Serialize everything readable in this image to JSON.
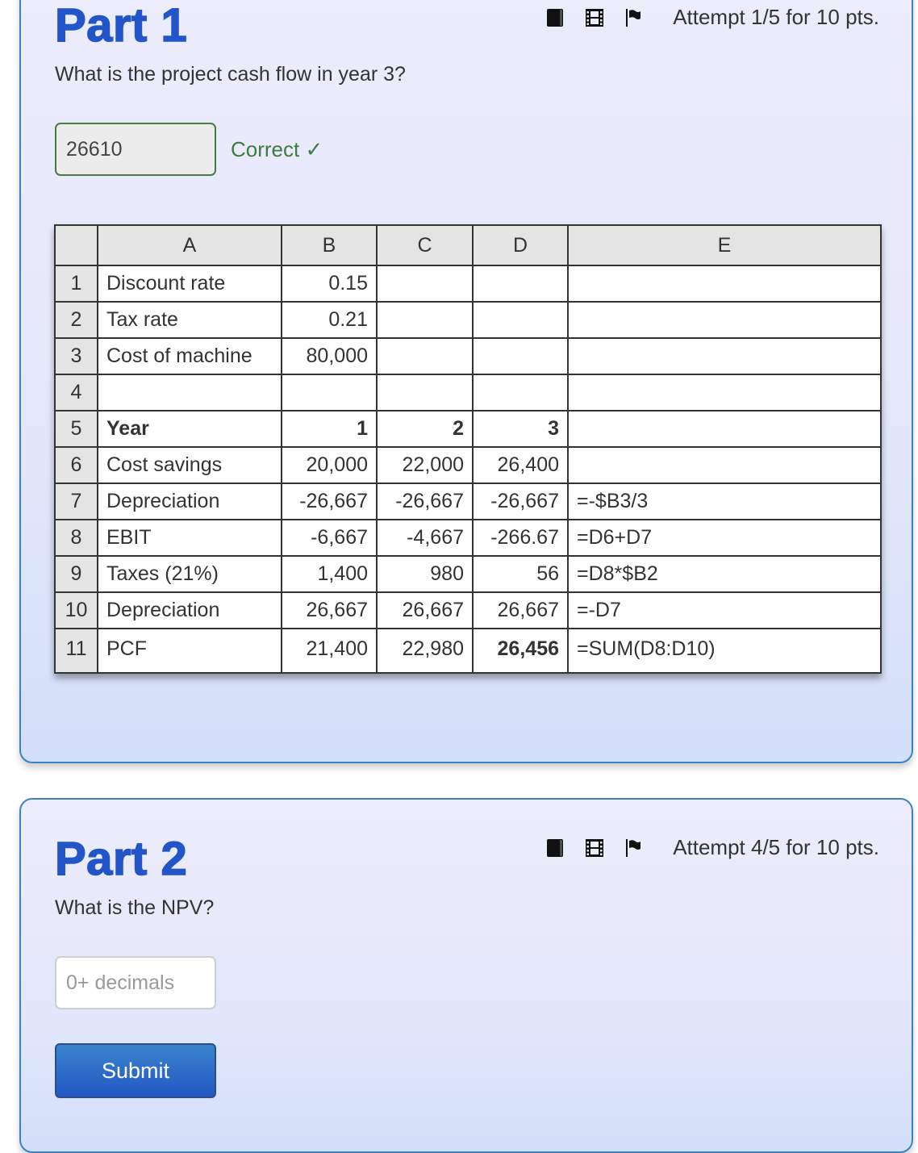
{
  "part1": {
    "title": "Part 1",
    "toolbar": {
      "icons": [
        "book-icon",
        "film-icon",
        "flag-icon"
      ],
      "attempt_text": "Attempt 1/5 for 10 pts."
    },
    "question": "What is the project cash flow in year 3?",
    "answer_value": "26610",
    "feedback": "Correct ✓",
    "feedback_color": "#3e7b3e",
    "spreadsheet": {
      "columns": [
        "",
        "A",
        "B",
        "C",
        "D",
        "E"
      ],
      "rows": [
        {
          "num": "1",
          "A": "Discount rate",
          "B": "0.15",
          "C": "",
          "D": "",
          "E": ""
        },
        {
          "num": "2",
          "A": "Tax rate",
          "B": "0.21",
          "C": "",
          "D": "",
          "E": ""
        },
        {
          "num": "3",
          "A": "Cost of machine",
          "B": "80,000",
          "C": "",
          "D": "",
          "E": ""
        },
        {
          "num": "4",
          "A": "",
          "B": "",
          "C": "",
          "D": "",
          "E": ""
        },
        {
          "num": "5",
          "A": "Year",
          "B": "1",
          "C": "2",
          "D": "3",
          "E": ""
        },
        {
          "num": "6",
          "A": "Cost savings",
          "B": "20,000",
          "C": "22,000",
          "D": "26,400",
          "E": ""
        },
        {
          "num": "7",
          "A": "Depreciation",
          "B": "-26,667",
          "C": "-26,667",
          "D": "-26,667",
          "E": "=-$B3/3"
        },
        {
          "num": "8",
          "A": "EBIT",
          "B": "-6,667",
          "C": "-4,667",
          "D": "-266.67",
          "E": "=D6+D7"
        },
        {
          "num": "9",
          "A": "Taxes (21%)",
          "B": "1,400",
          "C": "980",
          "D": "56",
          "E": "=D8*$B2"
        },
        {
          "num": "10",
          "A": "Depreciation",
          "B": "26,667",
          "C": "26,667",
          "D": "26,667",
          "E": "=-D7"
        },
        {
          "num": "11",
          "A": "PCF",
          "B": "21,400",
          "C": "22,980",
          "D": "26,456",
          "E": "=SUM(D8:D10)"
        }
      ]
    }
  },
  "part2": {
    "title": "Part 2",
    "toolbar": {
      "icons": [
        "book-icon",
        "film-icon",
        "flag-icon"
      ],
      "attempt_text": "Attempt 4/5 for 10 pts."
    },
    "question": "What is the NPV?",
    "answer_value": "",
    "answer_placeholder": "0+ decimals",
    "submit_label": "Submit"
  },
  "colors": {
    "title_blue": "#2255c8",
    "card_border": "#3b82c4",
    "button_blue": "#2357c4"
  }
}
